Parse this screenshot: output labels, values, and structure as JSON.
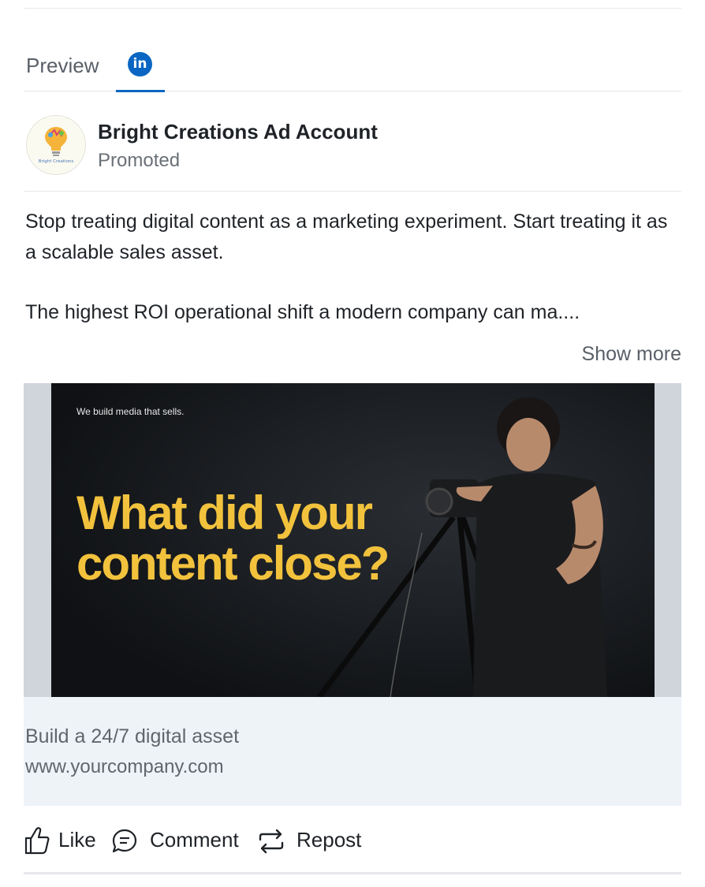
{
  "tabs": {
    "preview_label": "Preview",
    "active_icon": "linkedin-icon",
    "linkedin_badge_text": "in"
  },
  "header": {
    "account_name": "Bright Creations Ad Account",
    "subtitle": "Promoted",
    "avatar_logo_text": "Bright Creations"
  },
  "post": {
    "paragraph1": "Stop treating digital content as a marketing experiment. Start treating it as a scalable sales asset.",
    "paragraph2": "The highest ROI operational shift a modern company can ma....",
    "show_more_label": "Show more"
  },
  "media": {
    "tagline": "We build media that sells.",
    "headline_line1": "What did your",
    "headline_line2": "content close?",
    "headline_color": "#f2c23d"
  },
  "link_card": {
    "title": "Build a 24/7 digital asset",
    "url": "www.yourcompany.com"
  },
  "actions": {
    "like_label": "Like",
    "comment_label": "Comment",
    "repost_label": "Repost"
  },
  "colors": {
    "linkedin_blue": "#0a66c2",
    "link_card_bg": "#eef3f8"
  }
}
